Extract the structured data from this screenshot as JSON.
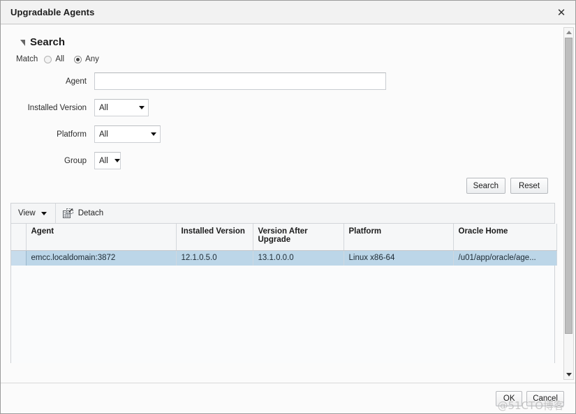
{
  "window": {
    "title": "Upgradable Agents",
    "close_icon": "close-icon"
  },
  "search": {
    "section_title": "Search",
    "disclosure_icon": "triangle-expanded-icon",
    "match_label": "Match",
    "match_options": [
      {
        "label": "All",
        "selected": false
      },
      {
        "label": "Any",
        "selected": true
      }
    ],
    "fields": {
      "agent": {
        "label": "Agent",
        "value": "",
        "placeholder": ""
      },
      "installed_version": {
        "label": "Installed Version",
        "value": "All"
      },
      "platform": {
        "label": "Platform",
        "value": "All"
      },
      "group": {
        "label": "Group",
        "value": "All"
      }
    },
    "buttons": {
      "search": "Search",
      "reset": "Reset"
    }
  },
  "table": {
    "toolbar": {
      "view_label": "View",
      "view_caret_icon": "chevron-down-icon",
      "detach_label": "Detach",
      "detach_icon": "detach-icon"
    },
    "columns": [
      "Agent",
      "Installed Version",
      "Version After Upgrade",
      "Platform",
      "Oracle Home"
    ],
    "rows": [
      {
        "selected": true,
        "agent": "emcc.localdomain:3872",
        "installed_version": "12.1.0.5.0",
        "version_after_upgrade": "13.1.0.0.0",
        "platform": "Linux x86-64",
        "oracle_home": "/u01/app/oracle/age..."
      }
    ]
  },
  "scrollbar": {
    "up_icon": "scroll-up-arrow-icon",
    "down_icon": "scroll-down-arrow-icon"
  },
  "footer": {
    "ok_label": "OK",
    "cancel_label": "Cancel",
    "watermark": "@51CTO博客"
  },
  "colors": {
    "selected_row": "#bcd6e8",
    "titlebar": "#f2f2f2",
    "panel_border": "#cfd2d6"
  }
}
